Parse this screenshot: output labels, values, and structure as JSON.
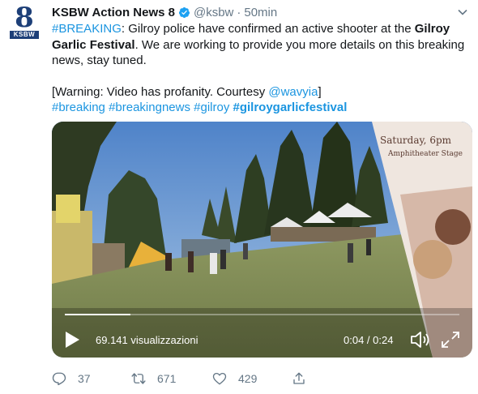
{
  "account": {
    "name": "KSBW Action News 8",
    "handle": "@ksbw",
    "separator": "·",
    "time": "50min",
    "avatar_numeral": "8",
    "avatar_text": "KSBW"
  },
  "tweet": {
    "hashtag_breaking_upper": "#BREAKING",
    "text_1": ": Gilroy police have confirmed an active shooter at the ",
    "bold_1": "Gilroy Garlic Festival",
    "text_2": ". We are working to provide you more details on this breaking news, stay tuned.",
    "warning_prefix": "[Warning: Video has profanity. Courtesy ",
    "mention": "@wavyia",
    "warning_suffix": "]",
    "tags": [
      "#breaking",
      "#breakingnews",
      "#gilroy"
    ],
    "tag_bold": "#gilroygarlicfestival"
  },
  "video": {
    "views": "69.141 visualizzazioni",
    "timecode": "0:04 / 0:24",
    "progress": 0.167,
    "banner_line1": "Saturday, 6pm",
    "banner_line2": "Amphitheater Stage"
  },
  "actions": {
    "replies": "37",
    "retweets": "671",
    "likes": "429"
  },
  "colors": {
    "link": "#1b95e0",
    "muted": "#657786",
    "text": "#14171a",
    "brand": "#1d3f78",
    "verified": "#1da1f2"
  }
}
